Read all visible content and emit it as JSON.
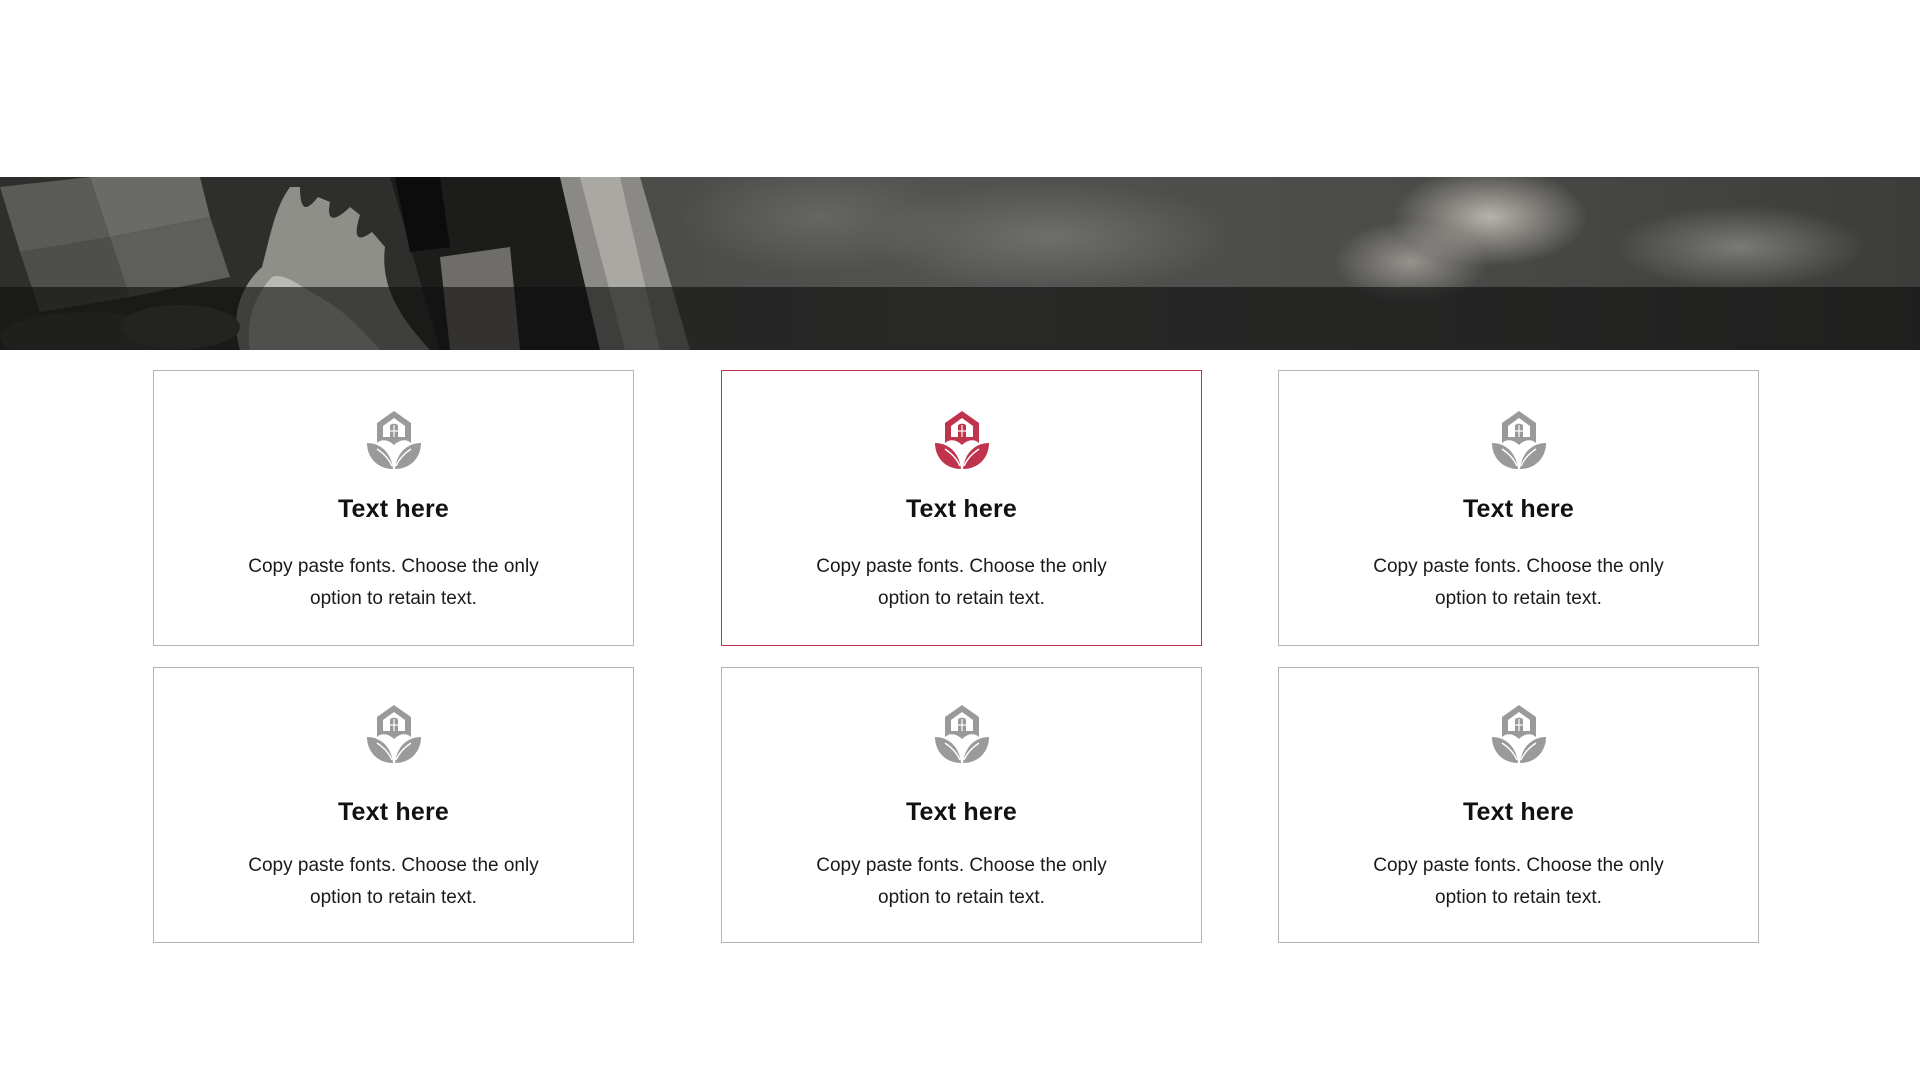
{
  "colors": {
    "accent": "#c0334c",
    "icon_default": "#9a9a9a",
    "border_default": "#b5b5b5"
  },
  "banner": {
    "icon": "statue-sky-photo"
  },
  "cards": [
    {
      "icon": "house-leaf-icon",
      "title": "Text here",
      "desc_line1": "Copy paste fonts. Choose the only",
      "desc_line2": "option to retain text.",
      "highlighted": false
    },
    {
      "icon": "house-leaf-icon",
      "title": "Text here",
      "desc_line1": "Copy paste fonts. Choose the only",
      "desc_line2": "option to retain text.",
      "highlighted": true
    },
    {
      "icon": "house-leaf-icon",
      "title": "Text here",
      "desc_line1": "Copy paste fonts. Choose the only",
      "desc_line2": "option to retain text.",
      "highlighted": false
    },
    {
      "icon": "house-leaf-icon",
      "title": "Text here",
      "desc_line1": "Copy paste fonts. Choose the only",
      "desc_line2": "option to retain text.",
      "highlighted": false
    },
    {
      "icon": "house-leaf-icon",
      "title": "Text here",
      "desc_line1": "Copy paste fonts. Choose the only",
      "desc_line2": "option to retain text.",
      "highlighted": false
    },
    {
      "icon": "house-leaf-icon",
      "title": "Text here",
      "desc_line1": "Copy paste fonts. Choose the only",
      "desc_line2": "option to retain text.",
      "highlighted": false
    }
  ]
}
